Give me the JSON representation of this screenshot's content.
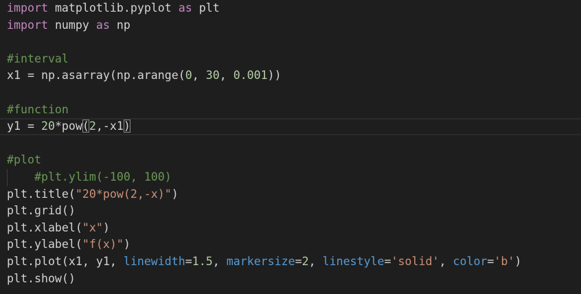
{
  "colors": {
    "background": "#1e1e1e",
    "keyword": "#c586c0",
    "text": "#d4d4d4",
    "number": "#b5cea8",
    "string": "#ce9178",
    "comment": "#6a9955",
    "parameter": "#569cd6"
  },
  "code": {
    "l1": {
      "kw1": "import",
      "t1": " matplotlib.pyplot ",
      "kw2": "as",
      "t2": " plt"
    },
    "l2": {
      "kw1": "import",
      "t1": " numpy ",
      "kw2": "as",
      "t2": " np"
    },
    "l4": {
      "cm": "#interval"
    },
    "l5": {
      "t1": "x1 = np.asarray(np.arange(",
      "n1": "0",
      "t2": ", ",
      "n2": "30",
      "t3": ", ",
      "n3": "0.001",
      "t4": "))"
    },
    "l7": {
      "cm": "#function"
    },
    "l8": {
      "t1": "y1 = ",
      "n1": "20",
      "t2": "*pow",
      "b1": "(",
      "n2": "2",
      "t3": ",-x1",
      "b2": ")"
    },
    "l10": {
      "cm": "#plot"
    },
    "l11": {
      "indent": "    ",
      "cm": "#plt.ylim(-100, 100)"
    },
    "l12": {
      "t1": "plt.title(",
      "s1": "\"20*pow(2,-x)\"",
      "t2": ")"
    },
    "l13": {
      "t1": "plt.grid()"
    },
    "l14": {
      "t1": "plt.xlabel(",
      "s1": "\"x\"",
      "t2": ")"
    },
    "l15": {
      "t1": "plt.ylabel(",
      "s1": "\"f(x)\"",
      "t2": ")"
    },
    "l16": {
      "t1": "plt.plot(x1, y1, ",
      "p1": "linewidth",
      "t2": "=",
      "n1": "1.5",
      "t3": ", ",
      "p2": "markersize",
      "t4": "=",
      "n2": "2",
      "t5": ", ",
      "p3": "linestyle",
      "t6": "=",
      "s1": "'solid'",
      "t7": ", ",
      "p4": "color",
      "t8": "=",
      "s2": "'b'",
      "t9": ")"
    },
    "l17": {
      "t1": "plt.show()"
    }
  }
}
